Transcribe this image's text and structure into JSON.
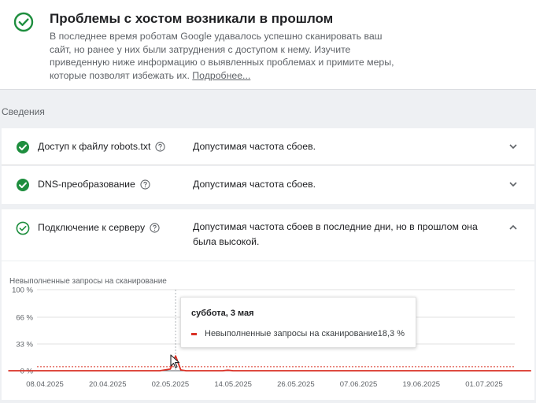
{
  "status": {
    "title": "Проблемы с хостом возникали в прошлом",
    "description": "В последнее время роботам Google удавалось успешно сканировать ваш сайт, но ранее у них были затруднения с доступом к нему. Изучите приведенную ниже информацию о выявленных проблемах и примите меры, которые позволят избежать их.",
    "more_link": "Подробнее..."
  },
  "section_label": "Сведения",
  "rows": [
    {
      "name": "Доступ к файлу robots.txt",
      "status": "Допустимая частота сбоев.",
      "expanded": false
    },
    {
      "name": "DNS-преобразование",
      "status": "Допустимая частота сбоев.",
      "expanded": false
    },
    {
      "name": "Подключение к серверу",
      "status": "Допустимая частота сбоев в последние дни, но в прошлом она была высокой.",
      "expanded": true
    }
  ],
  "colors": {
    "accent_green": "#1e8e3e",
    "series_red": "#d93025"
  },
  "tooltip": {
    "date": "суббота, 3 мая",
    "series_label": "Невыполненные запросы на сканирование",
    "value": "18,3 %"
  },
  "chart_data": {
    "type": "line",
    "title": "Невыполненные запросы на сканирование",
    "y_ticks": [
      "0 %",
      "33 %",
      "66 %",
      "100 %"
    ],
    "ylim": [
      0,
      100
    ],
    "x_ticks": [
      "08.04.2025",
      "20.04.2025",
      "02.05.2025",
      "14.05.2025",
      "26.05.2025",
      "07.06.2025",
      "19.06.2025",
      "01.07.2025"
    ],
    "threshold": 5,
    "series": [
      {
        "name": "Невыполненные запросы на сканирование",
        "color": "#d93025",
        "points": [
          {
            "x": "2025-04-01",
            "y": 0
          },
          {
            "x": "2025-04-30",
            "y": 0
          },
          {
            "x": "2025-05-02",
            "y": 2
          },
          {
            "x": "2025-05-03",
            "y": 18.3
          },
          {
            "x": "2025-05-04",
            "y": 1
          },
          {
            "x": "2025-05-05",
            "y": 0
          },
          {
            "x": "2025-05-12",
            "y": 0
          },
          {
            "x": "2025-05-13",
            "y": 0.7
          },
          {
            "x": "2025-05-14",
            "y": 0
          },
          {
            "x": "2025-07-10",
            "y": 0
          }
        ]
      }
    ]
  }
}
